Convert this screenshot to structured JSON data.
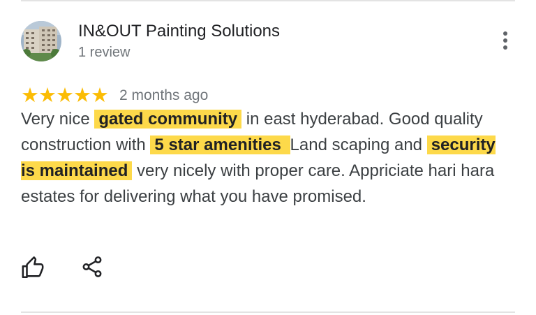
{
  "review": {
    "author_name": "IN&OUT Painting Solutions",
    "author_review_count": "1 review",
    "rating_stars": 5,
    "stars_text": "★★★★★",
    "time_ago": "2 months ago",
    "text": {
      "p1": "Very nice ",
      "h1": "gated community",
      "p2": " in east hyderabad. Good quality construction with ",
      "h2": "5 star amenities ",
      "p3": " Land scaping and ",
      "h3": "security is maintained",
      "p4": " very nicely with proper care. Appriciate hari hara estates for delivering what you have promised."
    }
  },
  "icons": {
    "more": "more-vert-icon",
    "like": "thumb-up-icon",
    "share": "share-icon"
  },
  "colors": {
    "star": "#fbbc04",
    "highlight": "#fdd94a",
    "primary_text": "#202124",
    "secondary_text": "#70757a"
  }
}
